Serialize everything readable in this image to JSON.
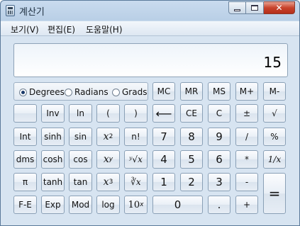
{
  "window": {
    "title": "계산기",
    "minimize": "–",
    "maximize": "□",
    "close": "✕"
  },
  "menu": [
    "보기(V)",
    "편집(E)",
    "도움말(H)"
  ],
  "display": {
    "value": "15"
  },
  "angle": {
    "options": [
      "Degrees",
      "Radians",
      "Grads"
    ],
    "selected": "Degrees"
  },
  "memory": [
    "MC",
    "MR",
    "MS",
    "M+",
    "M-"
  ],
  "keys": {
    "blank": "",
    "inv": "Inv",
    "ln": "ln",
    "lparen": "(",
    "rparen": ")",
    "backspace": "⟵",
    "ce": "CE",
    "c": "C",
    "plusminus": "±",
    "sqrt": "√",
    "int": "Int",
    "sinh": "sinh",
    "sin": "sin",
    "x2_base": "x",
    "x2_exp": "2",
    "fact": "n!",
    "n7": "7",
    "n8": "8",
    "n9": "9",
    "div": "/",
    "pct": "%",
    "dms": "dms",
    "cosh": "cosh",
    "cos": "cos",
    "xy_base": "x",
    "xy_exp": "y",
    "yroot": "ʸ√x",
    "n4": "4",
    "n5": "5",
    "n6": "6",
    "mul": "*",
    "recip": "1/x",
    "pi": "π",
    "tanh": "tanh",
    "tan": "tan",
    "x3_base": "x",
    "x3_exp": "3",
    "cuberoot": "∛x",
    "n1": "1",
    "n2": "2",
    "n3": "3",
    "sub": "-",
    "eq": "=",
    "fe": "F-E",
    "exp": "Exp",
    "mod": "Mod",
    "log": "log",
    "tenx_base": "10",
    "tenx_exp": "x",
    "n0": "0",
    "dot": ".",
    "add": "+"
  }
}
